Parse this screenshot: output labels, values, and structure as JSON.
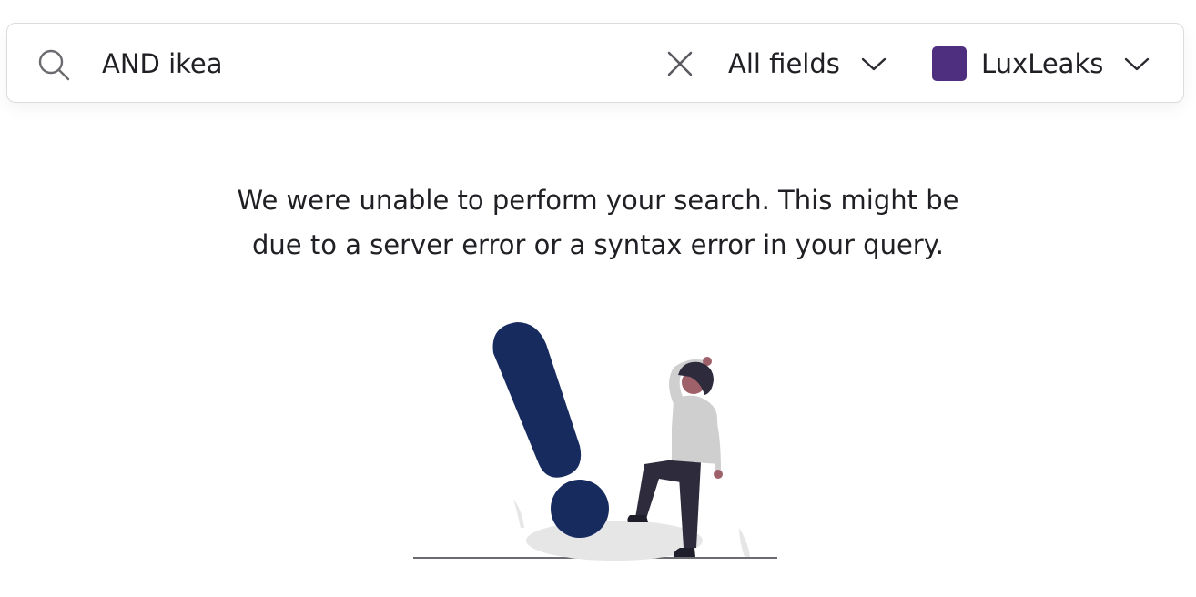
{
  "search": {
    "query": "AND ikea",
    "field_selector": {
      "selected": "All fields"
    },
    "project_selector": {
      "selected": "LuxLeaks",
      "color": "#4e2e7f"
    }
  },
  "icons": {
    "search": "search-icon",
    "clear": "close-icon",
    "field_dropdown": "chevron-down-icon",
    "project_dropdown": "chevron-down-icon"
  },
  "error": {
    "line1": "We were unable to perform your search. This might be",
    "line2": "due to a server error or a syntax error in your query."
  },
  "colors": {
    "exclamation": "#172b5e",
    "text": "#1f1f24",
    "border": "#dcdce0"
  }
}
